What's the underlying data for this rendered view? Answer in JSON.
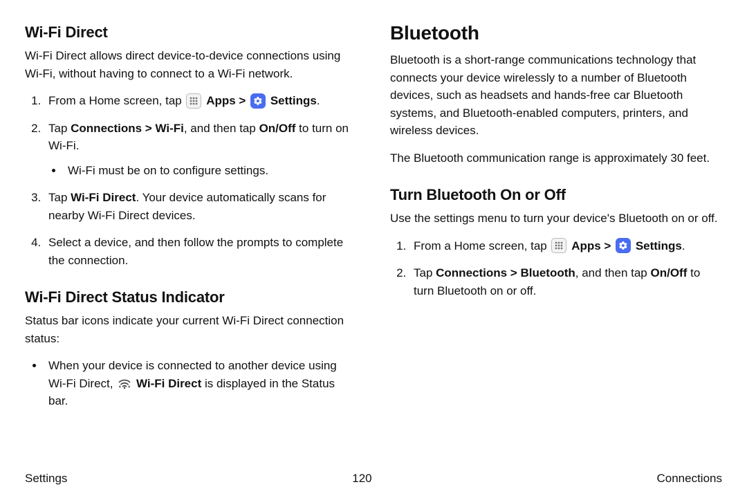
{
  "left": {
    "h2a": "Wi-Fi Direct",
    "p1": "Wi-Fi Direct allows direct device-to-device connections using Wi-Fi, without having to connect to a Wi-Fi network.",
    "step1_a": "From a Home screen, tap ",
    "step1_apps": "Apps",
    "step1_sep": " > ",
    "step1_settings": "Settings",
    "step1_end": ".",
    "step2_a": "Tap ",
    "step2_b": "Connections > Wi-Fi",
    "step2_c": ", and then tap ",
    "step2_d": "On/Off",
    "step2_e": " to turn on Wi-Fi.",
    "step2_sub": "Wi-Fi must be on to configure settings.",
    "step3_a": "Tap ",
    "step3_b": "Wi-Fi Direct",
    "step3_c": ". Your device automatically scans for nearby Wi-Fi Direct devices.",
    "step4": "Select a device, and then follow the prompts to complete the connection.",
    "h2b": "Wi-Fi Direct Status Indicator",
    "p2": "Status bar icons indicate your current Wi-Fi Direct connection status:",
    "bullet_a": "When your device is connected to another device using Wi-Fi Direct, ",
    "bullet_b": "Wi-Fi Direct",
    "bullet_c": " is displayed in the Status bar."
  },
  "right": {
    "h1": "Bluetooth",
    "p1": "Bluetooth is a short-range communications technology that connects your device wirelessly to a number of Bluetooth devices, such as headsets and hands-free car Bluetooth systems, and Bluetooth-enabled computers, printers, and wireless devices.",
    "p2": "The Bluetooth communication range is approximately 30 feet.",
    "h2": "Turn Bluetooth On or Off",
    "p3": "Use the settings menu to turn your device's Bluetooth on or off.",
    "step1_a": "From a Home screen, tap ",
    "step1_apps": "Apps",
    "step1_sep": " > ",
    "step1_settings": "Settings",
    "step1_end": ".",
    "step2_a": "Tap ",
    "step2_b": "Connections > Bluetooth",
    "step2_c": ", and then tap ",
    "step2_d": "On/Off",
    "step2_e": " to turn Bluetooth on or off."
  },
  "footer": {
    "left": "Settings",
    "center": "120",
    "right": "Connections"
  }
}
